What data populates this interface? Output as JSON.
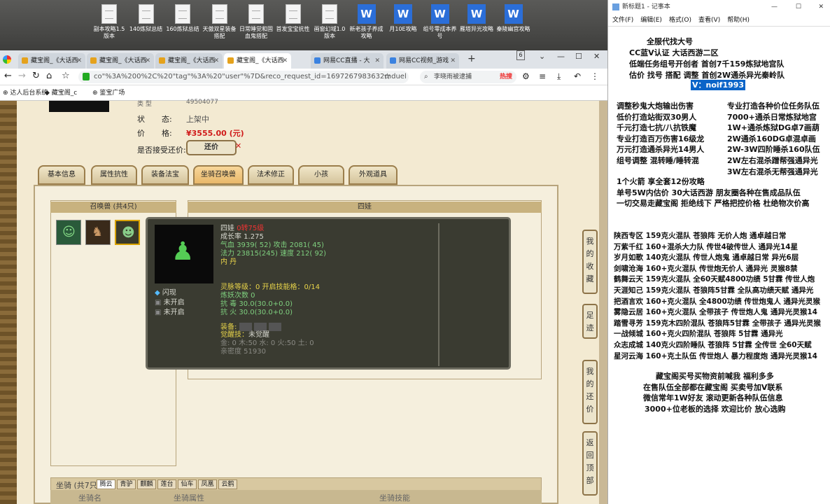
{
  "desktop": {
    "icons": [
      {
        "label": "副本攻略1.5版本",
        "type": "doc"
      },
      {
        "label": "140炼狱总结",
        "type": "doc"
      },
      {
        "label": "160炼狱总结",
        "type": "doc"
      },
      {
        "label": "天傲双星装备搭配",
        "type": "doc"
      },
      {
        "label": "日常睡觉和固血鬼搭配",
        "type": "doc"
      },
      {
        "label": "首发宝宝抗性",
        "type": "doc"
      },
      {
        "label": "画窗幻域1.0版本",
        "type": "doc"
      },
      {
        "label": "新老孩子养成攻略",
        "type": "word"
      },
      {
        "label": "月10E攻略",
        "type": "word"
      },
      {
        "label": "组号零成本养号",
        "type": "word"
      },
      {
        "label": "雁塔异光攻略",
        "type": "word"
      },
      {
        "label": "秦陵幽宫攻略",
        "type": "word"
      }
    ]
  },
  "browser": {
    "tabs": [
      {
        "label": "藏宝阁_《大话西"
      },
      {
        "label": "藏宝阁_《大话西"
      },
      {
        "label": "藏宝阁_《大话西"
      },
      {
        "label": "藏宝阁_《大话西"
      },
      {
        "label": "网易CC直播 - 大"
      },
      {
        "label": "网易CC视频_游戏"
      }
    ],
    "new_tab": "+",
    "tab_count": "6",
    "url": "co\"%3A%200%2C%20\"tag\"%3A%20\"user\"%7D&reco_request_id=1697267983632mduel",
    "search_text": "李晓雨被逮捕",
    "search_badge": "热搜",
    "bookmarks": [
      "达人后台系统",
      "藏宝阁_c",
      "鉴宝广场"
    ]
  },
  "game": {
    "status_label": "状",
    "status_label2": "态:",
    "status_value": "上架中",
    "price_label": "价",
    "price_label2": "格:",
    "price_value": "¥3555.00 (元)",
    "bargain_label": "是否接受还价:",
    "bargain_button": "还价",
    "top_cut_label": "类  型",
    "top_cut_value": "49504077",
    "tabs": [
      "基本信息",
      "属性抗性",
      "装备法宝",
      "坐骑召唤兽",
      "法术修正",
      "小孩",
      "外观道具"
    ],
    "selected_tab": "坐骑召唤兽",
    "pets_header": "召唤兽 (共4只)",
    "detail_header": "四娃",
    "mounts_label": "坐骑 (共7只)",
    "mount_tabs": [
      "腾云",
      "青驴",
      "麒麟",
      "莲台",
      "仙车",
      "凤凰",
      "云鹤"
    ],
    "mount_cols": [
      "坐骑名",
      "坐骑属性",
      "坐骑技能"
    ],
    "side_buttons": [
      "我的收藏",
      "足迹",
      "我的还价",
      "返回顶部"
    ],
    "popup": {
      "name": "四娃",
      "level": "0转75级",
      "growth": "成长率 1.275",
      "hp_label": "气血",
      "hp": "3939",
      "hp_extra": "( 52)",
      "atk_label": "攻击",
      "atk": "2081",
      "atk_extra": "( 45)",
      "mp_label": "法力",
      "mp": "23815",
      "mp_extra": "(245)",
      "spd_label": "速度",
      "spd": "212",
      "spd_extra": "( 92)",
      "element": "内  丹",
      "skills": [
        "闪现",
        "未开启",
        "未开启"
      ],
      "spirit_level": "灵脉等级：0 开启技能格：0/14",
      "demon_count": "炼妖次数 0",
      "resist_poison": "抗  毒 30.0(30.0+0.0)",
      "resist_fire": "抗  火 30.0(30.0+0.0)",
      "equip_label": "装备:",
      "awaken_label": "觉醒技：",
      "awaken_value": "未觉醒",
      "five_elements": "金: 0 木:50 水: 0 火:50 土: 0",
      "intimacy": "亲密度 51930"
    }
  },
  "notepad": {
    "title": "新标题1 - 记事本",
    "menu": [
      "文件(F)",
      "编辑(E)",
      "格式(O)",
      "查看(V)",
      "帮助(H)"
    ],
    "lines_top": [
      "全服代找大号",
      "CC蓝V认证           大话西游二区",
      "低端任务组号开创者           首创7千159炼狱地宫队",
      "估价 找号 搭配 调整           首创2W通杀异光秦岭队"
    ],
    "contact": "V：noif1993",
    "col_left": [
      "调整秒鬼大炮输出伤害",
      "低价打造站街双30男人",
      "千元打造七抗/八抗铁魔",
      "专业打造百万伤害16级龙",
      "万元打造通杀异光14男人",
      "组号调整 混转睡/睡转混"
    ],
    "col_right": [
      "专业打造各种价位任务队伍",
      "7000+通杀日常炼狱地宫",
      "1W+通杀炼狱DG卓7画葫",
      "2W通杀160DG卓混卓画",
      "2W-3W四阶睡杀160队伍",
      "2W左右混杀蹭帮强通异光",
      "3W左右混杀无帮强通异光"
    ],
    "lines_mid": [
      "1个火箭 享全套12份攻略",
      "单号5W内估价 30大话西游           朋友圈各种在售成品队伍",
      "一切交易走藏宝阁 拒绝线下    严格把控价格 杜绝物次价高"
    ],
    "team_list": [
      "陕西专区 159克火混队 苍狼阵 无价人炮 通卓越日常",
      "万紫千红 160+混杀大力队 传世4破传世人 通异光14星",
      "岁月如歌 140克火混队 传世人炮鬼 通卓越日常 异光6层",
      "剑啸沧海 160+克火混队 传世炮无价人 通异光 灵猴8禁",
      "鹤舞云天 159克火混队 全60天赋4800功绩 5甘霖 传世人炮",
      "天涯知己 159克火混队 苍狼阵5甘霖 全队高功绩天赋 通异光",
      "把酒言欢 160+克火混队 全4800功绩 传世炮鬼人 通异光灵猴",
      "雾隐云居 160+克火混队 全带孩子 传世炮人鬼 通异光灵猴14",
      "踏雪寻芳 159克木四阶混队 苍狼阵5甘霖 全带孩子 通异光灵猴",
      "一战倾城 160+克火四阶混队 苍狼阵 5甘霖 通异光",
      "众志成城 140克火四阶睡队 苍狼阵 5甘霖 全传世 全60天赋",
      "星河云海 160+克土队伍 传世炮人 暴力程度炮 通异光灵猴14"
    ],
    "lines_bottom": [
      "藏宝阁买号买物资前喊我 福利多多",
      "在售队伍全部都在藏宝阁 买卖号加V联系",
      "微信常年1W好友 滚动更新各种队伍信息",
      "3000+位老板的选择 欢迎比价 放心选购"
    ]
  },
  "colors": {
    "accent_red": "#d01a1a",
    "popup_green": "#7fd07f",
    "popup_yellow": "#e8d44a",
    "selection_blue": "#0a64c8"
  }
}
